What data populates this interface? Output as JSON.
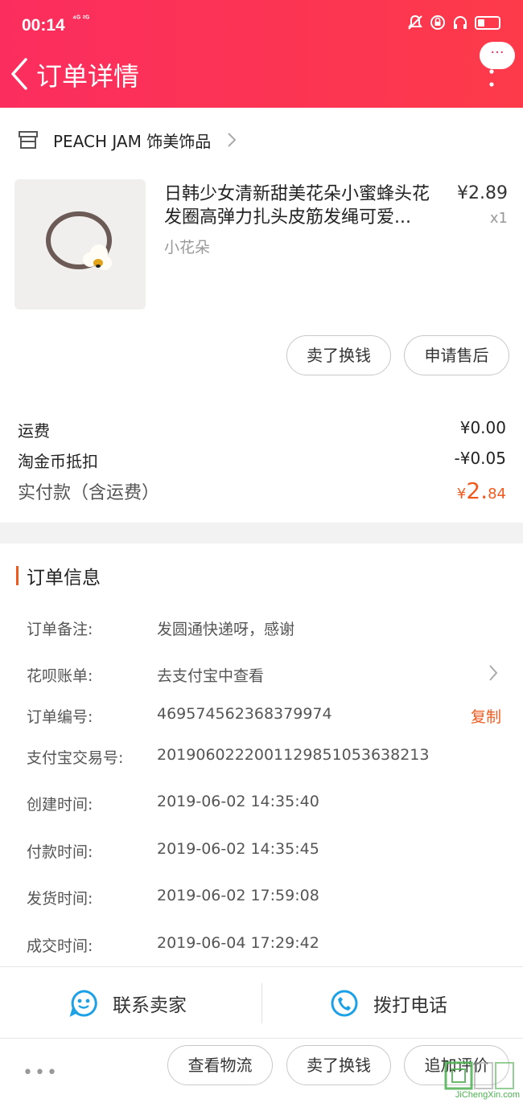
{
  "status_bar": {
    "time": "00:14",
    "network": "⁴ᴳ ²ᴳ"
  },
  "header": {
    "title": "订单详情",
    "more_label": "···"
  },
  "shop": {
    "name": "PEACH JAM 饰美饰品"
  },
  "item": {
    "title": "日韩少女清新甜美花朵小蜜蜂头花发圈高弹力扎头皮筋发绳可爱...",
    "variant": "小花朵",
    "price": "¥2.89",
    "qty": "x1",
    "actions": [
      "卖了换钱",
      "申请售后"
    ]
  },
  "fees": {
    "shipping_label": "运费",
    "shipping_value": "¥0.00",
    "coin_label": "淘金币抵扣",
    "coin_value": "-¥0.05",
    "total_label": "实付款（含运费）",
    "total_currency": "¥",
    "total_integer": "2.",
    "total_decimal": "84"
  },
  "order_info": {
    "heading": "订单信息",
    "rows": [
      {
        "label": "订单备注:",
        "value": "发圆通快递呀，感谢"
      },
      {
        "label": "花呗账单:",
        "value": "去支付宝中查看"
      },
      {
        "label": "订单编号:",
        "value": "469574562368379974",
        "action": "复制"
      },
      {
        "label": "支付宝交易号:",
        "value": "2019060222001129851053638213"
      },
      {
        "label": "创建时间:",
        "value": "2019-06-02 14:35:40"
      },
      {
        "label": "付款时间:",
        "value": "2019-06-02 14:35:45"
      },
      {
        "label": "发货时间:",
        "value": "2019-06-02 17:59:08"
      },
      {
        "label": "成交时间:",
        "value": "2019-06-04 17:29:42"
      }
    ]
  },
  "contact": {
    "seller_label": "联系卖家",
    "phone_label": "拨打电话"
  },
  "bottom_bar": {
    "dots": "•••",
    "buttons": [
      "查看物流",
      "卖了换钱",
      "追加评价"
    ]
  },
  "watermark": {
    "text": "JiChengXin.com"
  },
  "colors": {
    "header_gradient_start": "#fb2d5e",
    "header_gradient_end": "#fd3a4a",
    "accent_orange": "#f05a1e",
    "icon_blue": "#1da1e6"
  }
}
